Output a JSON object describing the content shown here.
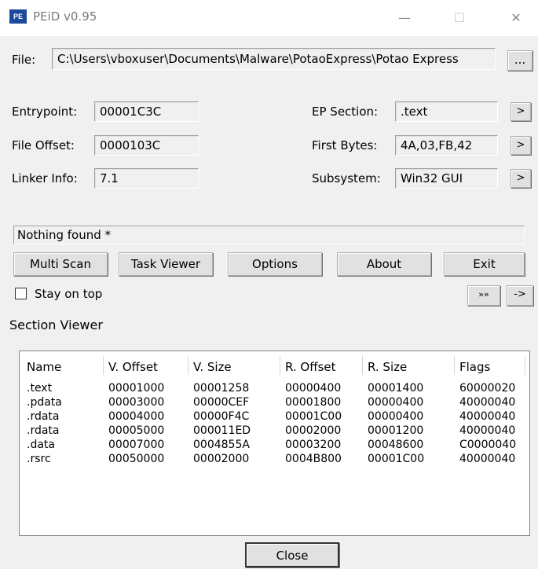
{
  "window": {
    "title": "PEiD v0.95",
    "icon_text": "PE",
    "controls": {
      "minimize": "—",
      "maximize": "☐",
      "close": "✕"
    }
  },
  "file": {
    "label": "File:",
    "path": "C:\\Users\\vboxuser\\Documents\\Malware\\PotaoExpress\\Potao Express",
    "browse_label": "..."
  },
  "info": {
    "entrypoint": {
      "label": "Entrypoint:",
      "value": "00001C3C"
    },
    "file_offset": {
      "label": "File Offset:",
      "value": "0000103C"
    },
    "linker_info": {
      "label": "Linker Info:",
      "value": "7.1"
    },
    "ep_section": {
      "label": "EP Section:",
      "value": ".text",
      "button": ">"
    },
    "first_bytes": {
      "label": "First Bytes:",
      "value": "4A,03,FB,42",
      "button": ">"
    },
    "subsystem": {
      "label": "Subsystem:",
      "value": "Win32 GUI",
      "button": ">"
    }
  },
  "status_text": "Nothing found *",
  "buttons": {
    "multi_scan": "Multi Scan",
    "task_viewer": "Task Viewer",
    "options": "Options",
    "about": "About",
    "exit": "Exit",
    "extra": "»»",
    "arrow": "->"
  },
  "stay_on_top": {
    "label": "Stay on top",
    "checked": false
  },
  "section_viewer": {
    "label": "Section Viewer",
    "columns": [
      "Name",
      "V. Offset",
      "V. Size",
      "R. Offset",
      "R. Size",
      "Flags"
    ],
    "rows": [
      [
        ".text",
        "00001000",
        "00001258",
        "00000400",
        "00001400",
        "60000020"
      ],
      [
        ".pdata",
        "00003000",
        "00000CEF",
        "00001800",
        "00000400",
        "40000040"
      ],
      [
        ".rdata",
        "00004000",
        "00000F4C",
        "00001C00",
        "00000400",
        "40000040"
      ],
      [
        ".rdata",
        "00005000",
        "000011ED",
        "00002000",
        "00001200",
        "40000040"
      ],
      [
        ".data",
        "00007000",
        "0004855A",
        "00003200",
        "00048600",
        "C0000040"
      ],
      [
        ".rsrc",
        "00050000",
        "00002000",
        "0004B800",
        "00001C00",
        "40000040"
      ]
    ],
    "close_label": "Close"
  }
}
